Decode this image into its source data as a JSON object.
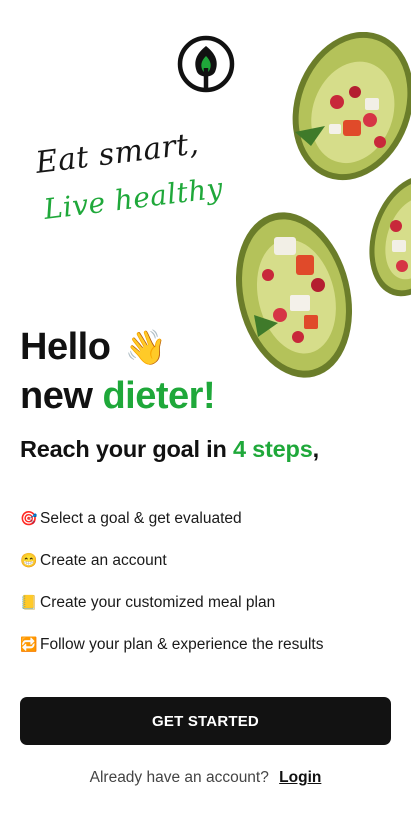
{
  "brand": {
    "logo_icon": "leaf-logo-icon",
    "color_green": "#1fa83a",
    "color_dark": "#121212"
  },
  "tagline": {
    "line1": "Eat smart,",
    "line2": "Live healthy"
  },
  "hero": {
    "hello": "Hello",
    "wave_emoji": "👋",
    "new": "new",
    "dieter": "dieter!"
  },
  "subhead": {
    "prefix": "Reach your goal in",
    "highlight": "4 steps",
    "suffix": ","
  },
  "steps": [
    {
      "emoji": "🎯",
      "label": "Select a goal & get evaluated"
    },
    {
      "emoji": "😁",
      "label": "Create an account"
    },
    {
      "emoji": "📒",
      "label": "Create your customized meal plan"
    },
    {
      "emoji": "🔁",
      "label": "Follow your plan & experience the results"
    }
  ],
  "cta": {
    "label": "GET STARTED"
  },
  "login": {
    "prompt": "Already have an account?",
    "link": "Login"
  }
}
